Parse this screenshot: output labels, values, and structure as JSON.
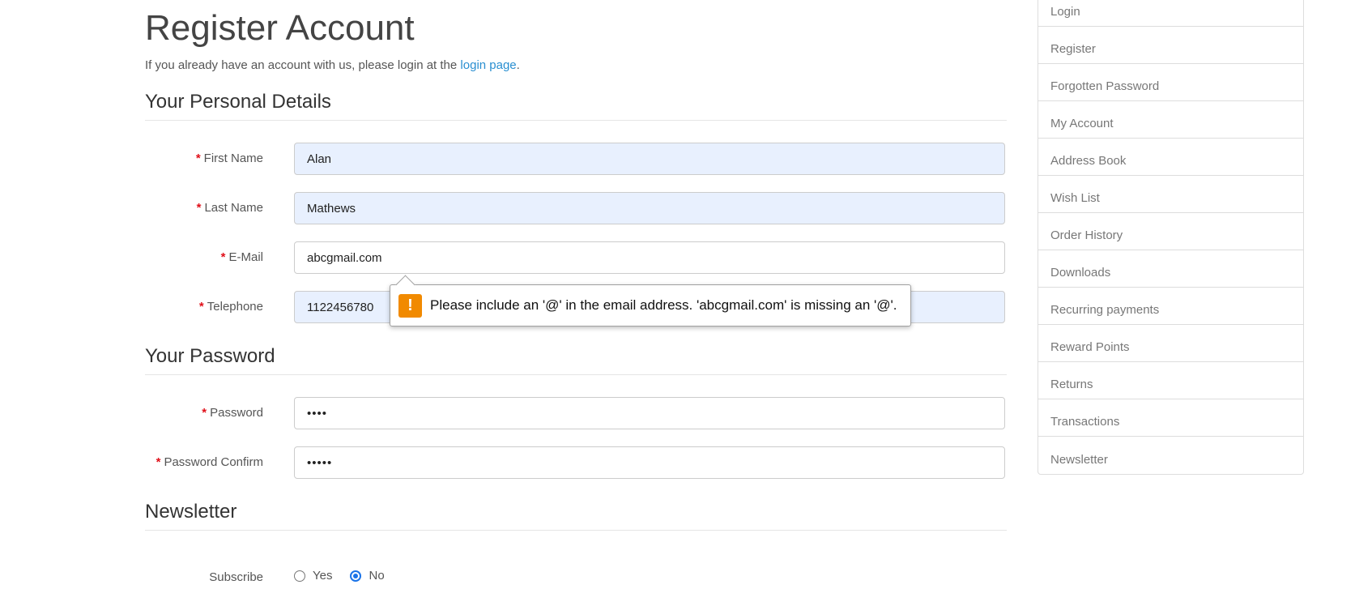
{
  "title": "Register Account",
  "intro": {
    "text": "If you already have an account with us, please login at the ",
    "link": "login page",
    "suffix": "."
  },
  "sections": {
    "personal": "Your Personal Details",
    "password": "Your Password",
    "newsletter": "Newsletter"
  },
  "required_mark": "*",
  "fields": {
    "firstname": {
      "label": "First Name",
      "value": "Alan"
    },
    "lastname": {
      "label": "Last Name",
      "value": "Mathews"
    },
    "email": {
      "label": "E-Mail",
      "value": "abcgmail.com"
    },
    "telephone": {
      "label": "Telephone",
      "value": "1122456780"
    },
    "password": {
      "label": "Password",
      "value": "••••"
    },
    "confirm": {
      "label": "Password Confirm",
      "value": "•••••"
    }
  },
  "validation": {
    "icon": "!",
    "message": "Please include an '@' in the email address. 'abcgmail.com' is missing an '@'."
  },
  "subscribe": {
    "label": "Subscribe",
    "yes": "Yes",
    "no": "No",
    "selected": "No"
  },
  "sidebar": {
    "items": [
      {
        "label": "Login"
      },
      {
        "label": "Register"
      },
      {
        "label": "Forgotten Password"
      },
      {
        "label": "My Account"
      },
      {
        "label": "Address Book"
      },
      {
        "label": "Wish List"
      },
      {
        "label": "Order History"
      },
      {
        "label": "Downloads"
      },
      {
        "label": "Recurring payments"
      },
      {
        "label": "Reward Points"
      },
      {
        "label": "Returns"
      },
      {
        "label": "Transactions"
      },
      {
        "label": "Newsletter"
      }
    ]
  },
  "colors": {
    "link": "#2a8fd1",
    "required": "#e0101a",
    "autofill_bg": "#e8f0fe",
    "warning_icon": "#f18a00",
    "radio_checked": "#1a73e8"
  }
}
